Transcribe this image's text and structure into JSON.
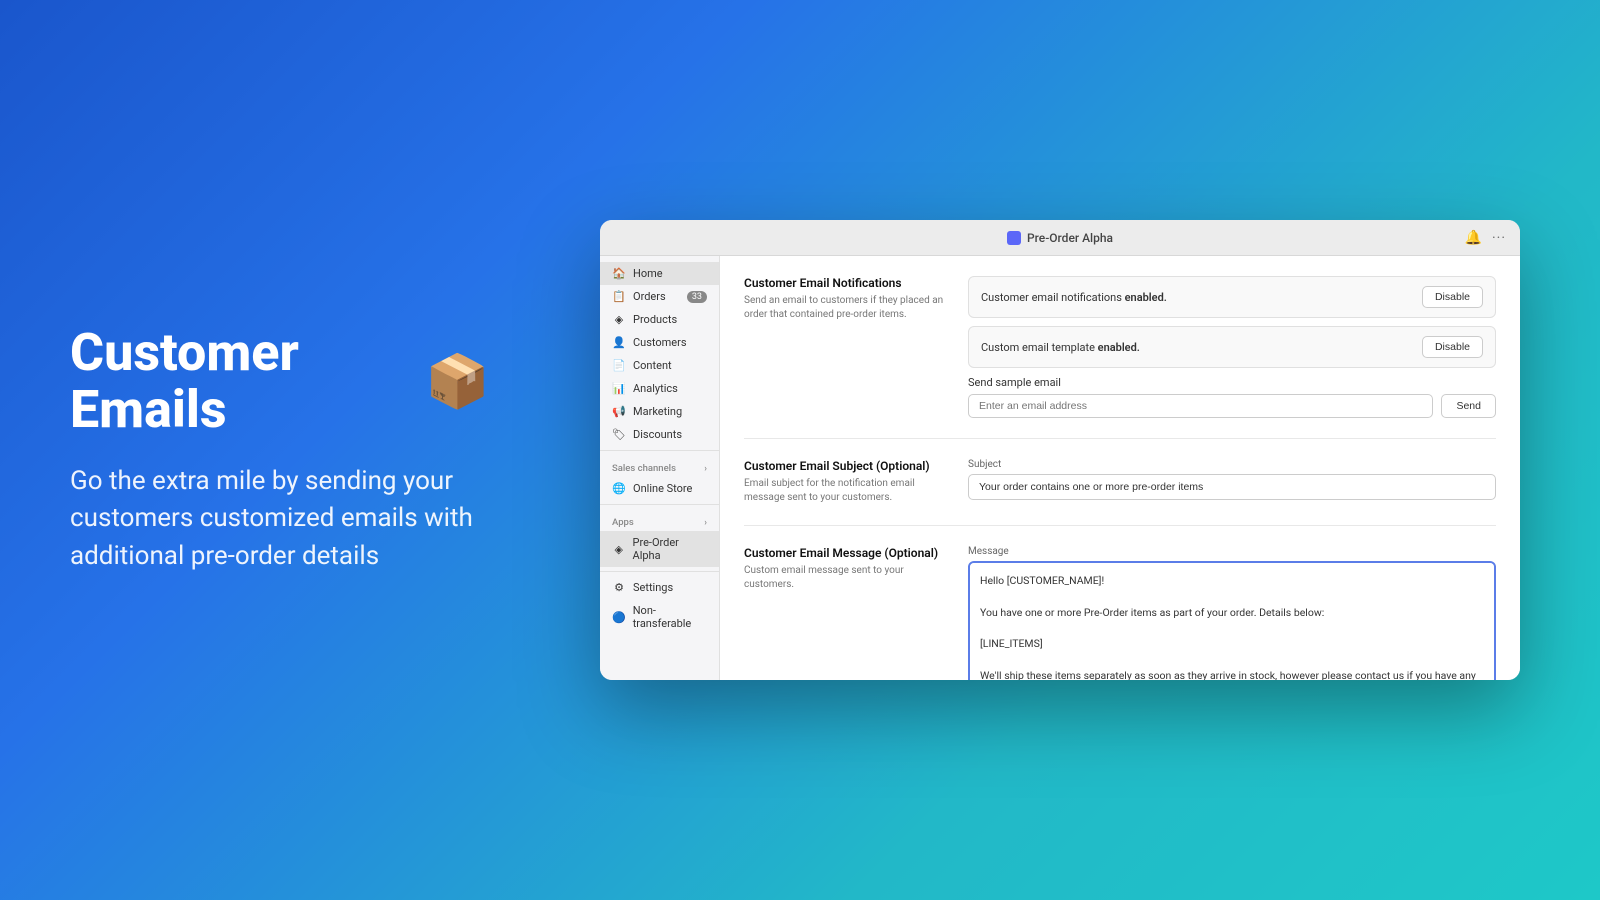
{
  "background": {
    "gradient_start": "#1a56cc",
    "gradient_end": "#1ec8c8"
  },
  "left_panel": {
    "heading": "Customer Emails",
    "heading_icon": "📦",
    "subtext": "Go the extra mile by sending your customers customized emails with additional pre-order details"
  },
  "window": {
    "title_bar": {
      "title": "Pre-Order Alpha",
      "icon_color": "#5b67f8"
    },
    "sidebar": {
      "items": [
        {
          "label": "Home",
          "icon": "🏠",
          "active": true,
          "badge": null
        },
        {
          "label": "Orders",
          "icon": "📋",
          "active": false,
          "badge": "33"
        },
        {
          "label": "Products",
          "icon": "◈",
          "active": false,
          "badge": null
        },
        {
          "label": "Customers",
          "icon": "👤",
          "active": false,
          "badge": null
        },
        {
          "label": "Content",
          "icon": "📄",
          "active": false,
          "badge": null
        },
        {
          "label": "Analytics",
          "icon": "📊",
          "active": false,
          "badge": null
        },
        {
          "label": "Marketing",
          "icon": "📢",
          "active": false,
          "badge": null
        },
        {
          "label": "Discounts",
          "icon": "🏷",
          "active": false,
          "badge": null
        }
      ],
      "sales_channels_label": "Sales channels",
      "sales_channels": [
        {
          "label": "Online Store",
          "icon": "🌐"
        }
      ],
      "apps_label": "Apps",
      "apps": [
        {
          "label": "Pre-Order Alpha",
          "icon": "◈",
          "active": true
        }
      ],
      "settings_label": "Settings",
      "non_transferable_label": "Non-transferable"
    },
    "main": {
      "sections": [
        {
          "id": "email-notifications",
          "title": "Customer Email Notifications",
          "description": "Send an email to customers if they placed an order that contained pre-order items.",
          "notification_enabled_text": "Customer email notifications ",
          "notification_enabled_bold": "enabled.",
          "notification_disable_label": "Disable",
          "template_enabled_text": "Custom email template ",
          "template_enabled_bold": "enabled.",
          "template_disable_label": "Disable",
          "send_sample_label": "Send sample email",
          "send_sample_placeholder": "Enter an email address",
          "send_btn_label": "Send"
        },
        {
          "id": "email-subject",
          "title": "Customer Email Subject (Optional)",
          "description": "Email subject for the notification email message sent to your customers.",
          "subject_field_label": "Subject",
          "subject_value": "Your order contains one or more pre-order items"
        },
        {
          "id": "email-message",
          "title": "Customer Email Message (Optional)",
          "description": "Custom email message sent to your customers.",
          "message_label": "Message",
          "message_value": "Hello [CUSTOMER_NAME]!\n\nYou have one or more Pre-Order items as part of your order. Details below:\n\n[LINE_ITEMS]\n\nWe'll ship these items separately as soon as they arrive in stock, however please contact us if you have any questions.\n\nSincerely,"
        }
      ]
    }
  }
}
